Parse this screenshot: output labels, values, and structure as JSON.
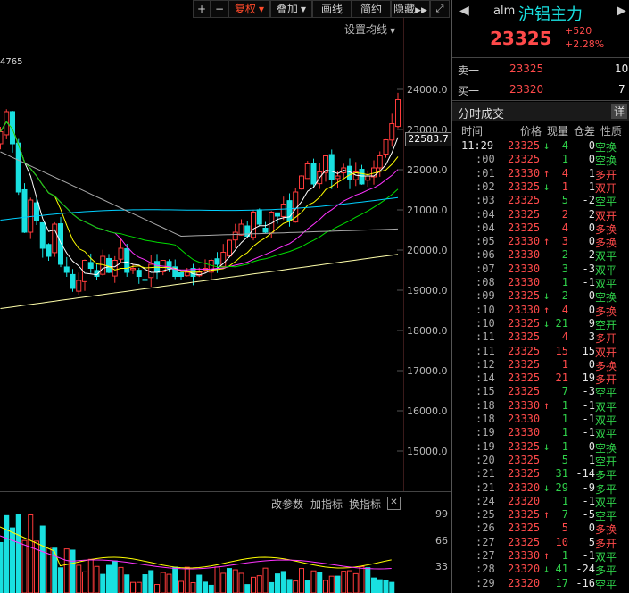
{
  "toolbar": {
    "plus": "+",
    "minus": "−",
    "fuquan": "复权",
    "diejia": "叠加",
    "huaxian": "画线",
    "jianyue": "简约",
    "yincang": "隐藏",
    "expand_icon": "expand-icon"
  },
  "chart": {
    "settings_label": "设置均线",
    "low_label": "4765",
    "last_price_label": "22583.7",
    "y_ticks": [
      "24000.0",
      "23000.0",
      "22000.0",
      "21000.0",
      "20000.0",
      "19000.0",
      "18000.0",
      "17000.0",
      "16000.0",
      "15000.0"
    ],
    "colors": {
      "up": "#ff3b3b",
      "down": "#19e0e0",
      "ma5": "#ffffff",
      "ma10": "#ffff00",
      "ma20": "#ff33ff",
      "ma30": "#00dd00",
      "ma60": "#aaaaaa",
      "ma120": "#00d0ff",
      "ma250": "#ffffaa"
    }
  },
  "indicator": {
    "buttons": [
      "改参数",
      "加指标",
      "换指标"
    ],
    "close_icon": "close-icon",
    "y_ticks": [
      "99",
      "66",
      "33"
    ]
  },
  "header": {
    "code": "alm",
    "name": "沪铝主力",
    "price": "23325",
    "change": "+520",
    "change_pct": "+2.28%"
  },
  "orderbook": [
    {
      "label": "卖一",
      "price": "23325",
      "qty": "10"
    },
    {
      "label": "买一",
      "price": "23320",
      "qty": "7"
    }
  ],
  "ticks_panel": {
    "title": "分时成交",
    "detail_btn": "详",
    "headers": [
      "时间",
      "价格",
      "现量",
      "仓差",
      "性质"
    ],
    "rows": [
      {
        "t": "11:29",
        "p": "23325",
        "arrow": "↓",
        "q": "4",
        "d": "0",
        "n": "空换",
        "c": "g"
      },
      {
        "t": ":00",
        "p": "23325",
        "arrow": "",
        "q": "1",
        "d": "0",
        "n": "空换",
        "c": "g"
      },
      {
        "t": ":01",
        "p": "23330",
        "arrow": "↑",
        "q": "4",
        "d": "1",
        "n": "多开",
        "c": "r"
      },
      {
        "t": ":02",
        "p": "23325",
        "arrow": "↓",
        "q": "1",
        "d": "1",
        "n": "双开",
        "c": "r"
      },
      {
        "t": ":03",
        "p": "23325",
        "arrow": "",
        "q": "5",
        "d": "-2",
        "n": "空平",
        "c": "g"
      },
      {
        "t": ":04",
        "p": "23325",
        "arrow": "",
        "q": "2",
        "d": "2",
        "n": "双开",
        "c": "r"
      },
      {
        "t": ":04",
        "p": "23325",
        "arrow": "",
        "q": "4",
        "d": "0",
        "n": "多换",
        "c": "r"
      },
      {
        "t": ":05",
        "p": "23330",
        "arrow": "↑",
        "q": "3",
        "d": "0",
        "n": "多换",
        "c": "r"
      },
      {
        "t": ":06",
        "p": "23330",
        "arrow": "",
        "q": "2",
        "d": "-2",
        "n": "双平",
        "c": "g"
      },
      {
        "t": ":07",
        "p": "23330",
        "arrow": "",
        "q": "3",
        "d": "-3",
        "n": "双平",
        "c": "g"
      },
      {
        "t": ":08",
        "p": "23330",
        "arrow": "",
        "q": "1",
        "d": "-1",
        "n": "双平",
        "c": "g"
      },
      {
        "t": ":09",
        "p": "23325",
        "arrow": "↓",
        "q": "2",
        "d": "0",
        "n": "空换",
        "c": "g"
      },
      {
        "t": ":10",
        "p": "23330",
        "arrow": "↑",
        "q": "4",
        "d": "0",
        "n": "多换",
        "c": "r"
      },
      {
        "t": ":10",
        "p": "23325",
        "arrow": "↓",
        "q": "21",
        "d": "9",
        "n": "空开",
        "c": "g"
      },
      {
        "t": ":11",
        "p": "23325",
        "arrow": "",
        "q": "4",
        "d": "3",
        "n": "多开",
        "c": "r"
      },
      {
        "t": ":11",
        "p": "23325",
        "arrow": "",
        "q": "15",
        "d": "15",
        "n": "双开",
        "c": "r"
      },
      {
        "t": ":12",
        "p": "23325",
        "arrow": "",
        "q": "1",
        "d": "0",
        "n": "多换",
        "c": "r"
      },
      {
        "t": ":14",
        "p": "23325",
        "arrow": "",
        "q": "21",
        "d": "19",
        "n": "多开",
        "c": "r"
      },
      {
        "t": ":15",
        "p": "23325",
        "arrow": "",
        "q": "7",
        "d": "-3",
        "n": "空平",
        "c": "g"
      },
      {
        "t": ":18",
        "p": "23330",
        "arrow": "↑",
        "q": "1",
        "d": "-1",
        "n": "双平",
        "c": "g"
      },
      {
        "t": ":18",
        "p": "23330",
        "arrow": "",
        "q": "1",
        "d": "-1",
        "n": "双平",
        "c": "g"
      },
      {
        "t": ":19",
        "p": "23330",
        "arrow": "",
        "q": "1",
        "d": "-1",
        "n": "双平",
        "c": "g"
      },
      {
        "t": ":19",
        "p": "23325",
        "arrow": "↓",
        "q": "1",
        "d": "0",
        "n": "空换",
        "c": "g"
      },
      {
        "t": ":20",
        "p": "23325",
        "arrow": "",
        "q": "5",
        "d": "1",
        "n": "空开",
        "c": "g"
      },
      {
        "t": ":21",
        "p": "23325",
        "arrow": "",
        "q": "31",
        "d": "-14",
        "n": "多平",
        "c": "g"
      },
      {
        "t": ":21",
        "p": "23320",
        "arrow": "↓",
        "q": "29",
        "d": "-9",
        "n": "多平",
        "c": "g"
      },
      {
        "t": ":24",
        "p": "23320",
        "arrow": "",
        "q": "1",
        "d": "-1",
        "n": "双平",
        "c": "g"
      },
      {
        "t": ":25",
        "p": "23325",
        "arrow": "↑",
        "q": "7",
        "d": "-5",
        "n": "空平",
        "c": "g"
      },
      {
        "t": ":26",
        "p": "23325",
        "arrow": "",
        "q": "5",
        "d": "0",
        "n": "多换",
        "c": "r"
      },
      {
        "t": ":27",
        "p": "23325",
        "arrow": "",
        "q": "10",
        "d": "5",
        "n": "多开",
        "c": "r"
      },
      {
        "t": ":27",
        "p": "23330",
        "arrow": "↑",
        "q": "1",
        "d": "-1",
        "n": "双平",
        "c": "g"
      },
      {
        "t": ":28",
        "p": "23320",
        "arrow": "↓",
        "q": "41",
        "d": "-24",
        "n": "多平",
        "c": "g"
      },
      {
        "t": ":29",
        "p": "23320",
        "arrow": "",
        "q": "17",
        "d": "-16",
        "n": "空平",
        "c": "g"
      }
    ]
  }
}
